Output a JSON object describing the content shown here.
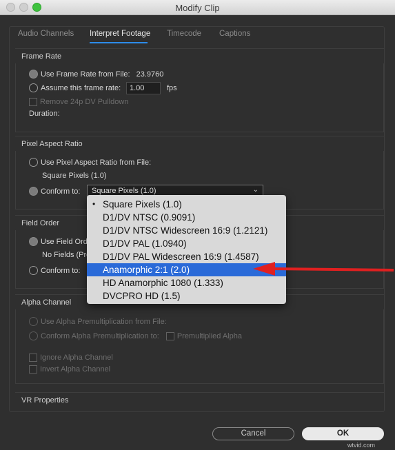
{
  "window": {
    "title": "Modify Clip"
  },
  "tabs": [
    {
      "label": "Audio Channels"
    },
    {
      "label": "Interpret Footage"
    },
    {
      "label": "Timecode"
    },
    {
      "label": "Captions"
    }
  ],
  "frame_rate": {
    "title": "Frame Rate",
    "use_from_file_label": "Use Frame Rate from File:",
    "use_from_file_value": "23.9760",
    "assume_label": "Assume this frame rate:",
    "assume_value": "1.00",
    "fps_unit": "fps",
    "remove_pulldown_label": "Remove 24p DV Pulldown",
    "duration_label": "Duration:"
  },
  "pixel_aspect": {
    "title": "Pixel Aspect Ratio",
    "use_from_file_label": "Use Pixel Aspect Ratio from File:",
    "file_value": "Square Pixels (1.0)",
    "conform_label": "Conform to:",
    "selected": "Square Pixels (1.0)",
    "options": [
      "Square Pixels (1.0)",
      "D1/DV NTSC (0.9091)",
      "D1/DV NTSC Widescreen 16:9 (1.2121)",
      "D1/DV PAL (1.0940)",
      "D1/DV PAL Widescreen 16:9 (1.4587)",
      "Anamorphic 2:1 (2.0)",
      "HD Anamorphic 1080 (1.333)",
      "DVCPRO HD (1.5)"
    ],
    "highlighted_option": "Anamorphic 2:1 (2.0)"
  },
  "field_order": {
    "title": "Field Order",
    "use_from_file_label": "Use Field Orde",
    "file_value": "No Fields (Pro",
    "conform_label": "Conform to:"
  },
  "alpha": {
    "title": "Alpha Channel",
    "use_premult_label": "Use Alpha Premultiplication from File:",
    "conform_premult_label": "Conform Alpha Premultiplication to:",
    "premultiplied_label": "Premultiplied Alpha",
    "ignore_label": "Ignore Alpha Channel",
    "invert_label": "Invert Alpha Channel"
  },
  "vr": {
    "title": "VR Properties"
  },
  "buttons": {
    "cancel": "Cancel",
    "ok": "OK"
  },
  "watermark": "wtvid.com",
  "colors": {
    "accent": "#2d8ceb",
    "selection": "#2a6ad8",
    "arrow": "#e02020"
  }
}
